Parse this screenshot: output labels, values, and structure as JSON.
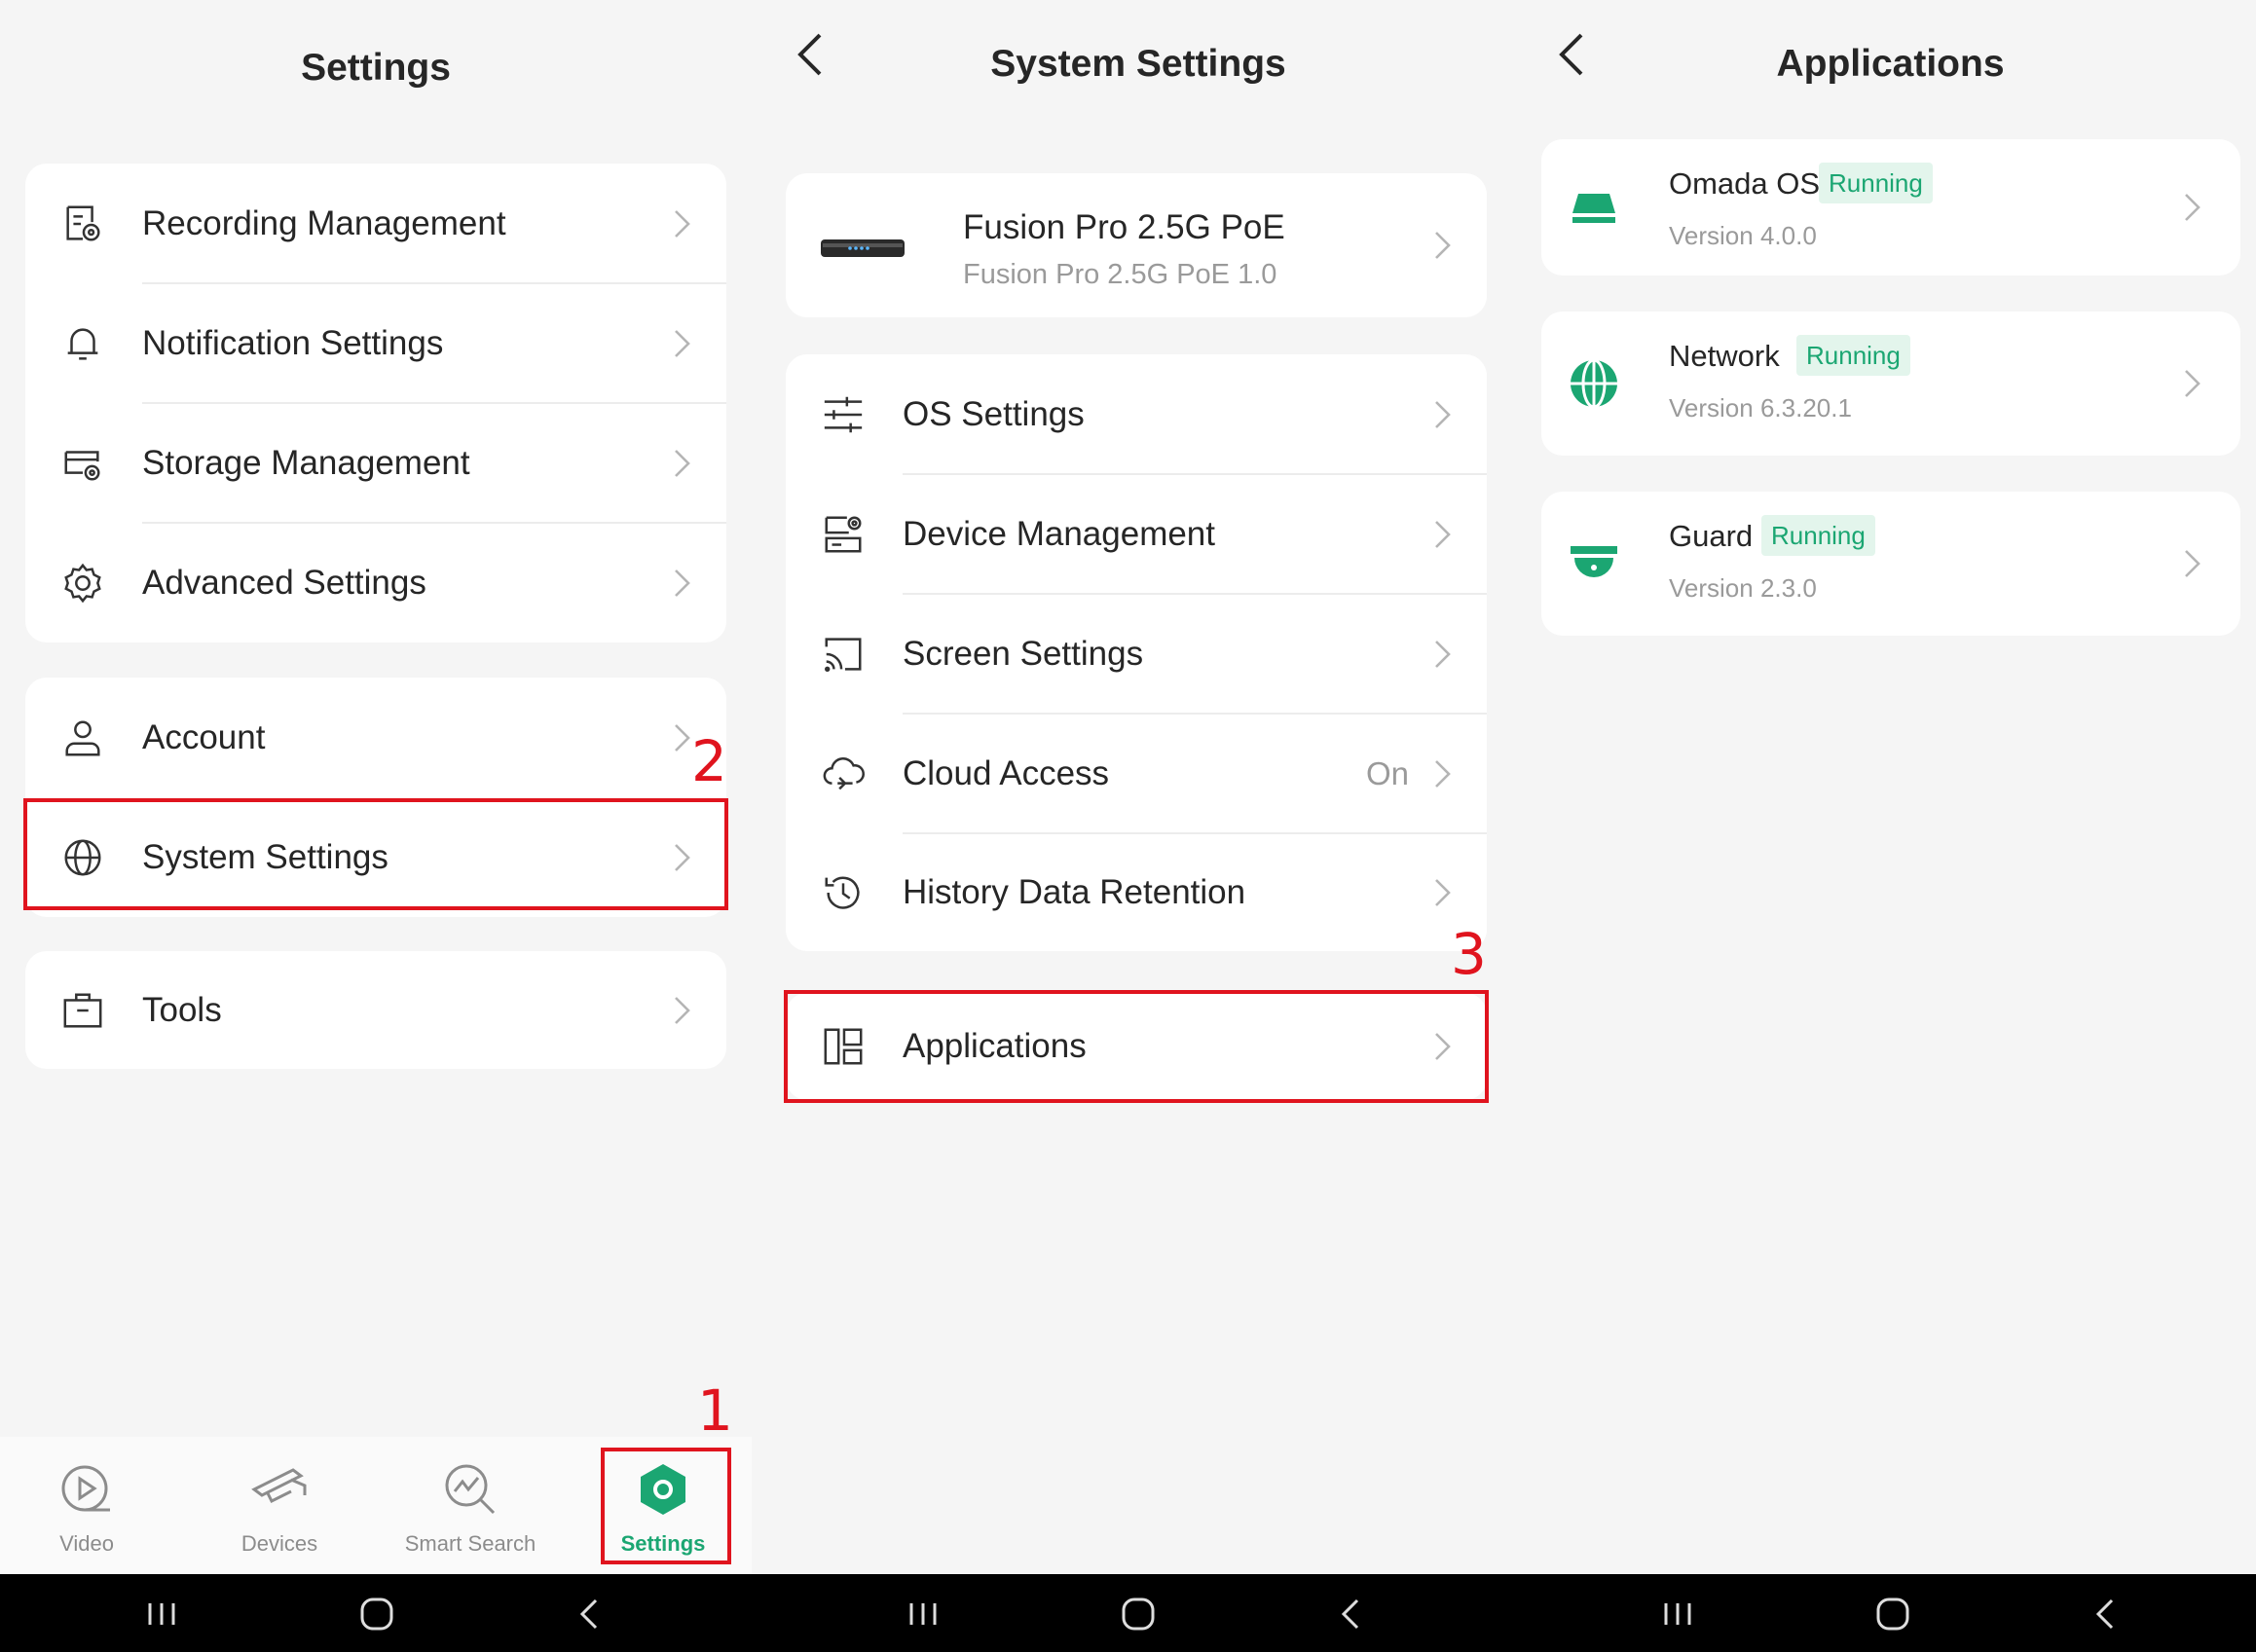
{
  "settings_panel": {
    "title": "Settings",
    "group1": [
      {
        "label": "Recording Management",
        "icon": "recording-management-icon"
      },
      {
        "label": "Notification Settings",
        "icon": "bell-icon"
      },
      {
        "label": "Storage Management",
        "icon": "storage-icon"
      },
      {
        "label": "Advanced Settings",
        "icon": "gear-icon"
      }
    ],
    "group2": [
      {
        "label": "Account",
        "icon": "user-icon"
      },
      {
        "label": "System Settings",
        "icon": "globe-icon"
      }
    ],
    "group3": [
      {
        "label": "Tools",
        "icon": "toolbox-icon"
      }
    ],
    "tabs": [
      {
        "label": "Video",
        "icon": "video-play-icon"
      },
      {
        "label": "Devices",
        "icon": "camera-icon"
      },
      {
        "label": "Smart Search",
        "icon": "smart-search-icon"
      },
      {
        "label": "Settings",
        "icon": "settings-hexagon-icon",
        "active": true
      }
    ]
  },
  "system_settings_panel": {
    "title": "System Settings",
    "device": {
      "name": "Fusion Pro 2.5G PoE",
      "subtitle": "Fusion Pro 2.5G PoE 1.0"
    },
    "items": [
      {
        "label": "OS Settings",
        "icon": "sliders-icon"
      },
      {
        "label": "Device Management",
        "icon": "device-management-icon"
      },
      {
        "label": "Screen Settings",
        "icon": "cast-icon"
      },
      {
        "label": "Cloud Access",
        "icon": "cloud-sync-icon",
        "value": "On"
      },
      {
        "label": "History Data Retention",
        "icon": "history-icon"
      }
    ],
    "applications": {
      "label": "Applications",
      "icon": "applications-grid-icon"
    }
  },
  "applications_panel": {
    "title": "Applications",
    "apps": [
      {
        "name": "Omada OS",
        "status": "Running",
        "version": "Version 4.0.0",
        "icon": "omada-os-icon"
      },
      {
        "name": "Network",
        "status": "Running",
        "version": "Version 6.3.20.1",
        "icon": "network-globe-icon"
      },
      {
        "name": "Guard",
        "status": "Running",
        "version": "Version 2.3.0",
        "icon": "guard-camera-icon"
      }
    ]
  },
  "step_markers": [
    "1",
    "2",
    "3"
  ],
  "colors": {
    "accent": "#1ba672",
    "highlight": "#e0141e",
    "badge_bg": "#e3f5ec"
  }
}
